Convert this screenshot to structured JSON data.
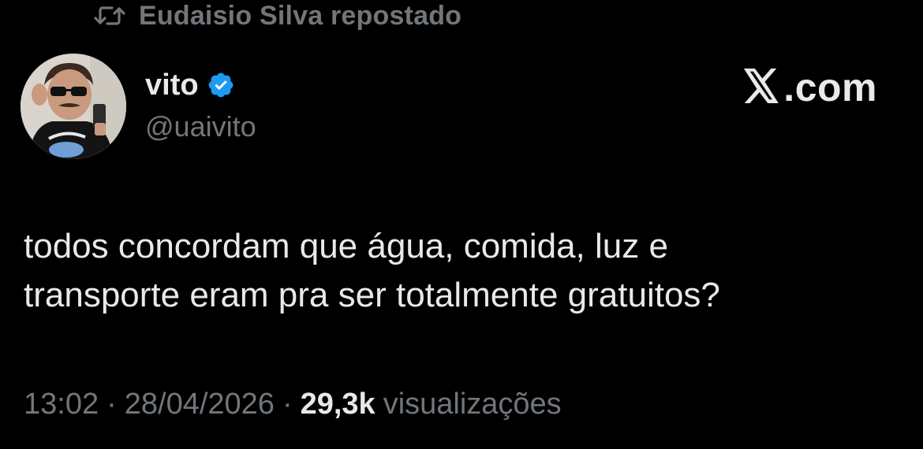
{
  "repost": {
    "icon": "repost-icon",
    "label": "Eudaisio Silva repostado"
  },
  "author": {
    "avatar_icon": "avatar",
    "display_name": "vito",
    "verified_icon": "verified-badge-icon",
    "verified_color": "#1d9bf0",
    "handle": "@uaivito"
  },
  "brand": {
    "logo_icon": "x-logo-icon",
    "label": ".com"
  },
  "tweet": {
    "lines": [
      "todos concordam que água, comida, luz e",
      "transporte eram pra ser totalmente gratuitos?"
    ]
  },
  "meta": {
    "time": "13:02",
    "separator": "·",
    "date": "28/04/2026",
    "views_count": "29,3k",
    "views_label": "visualizações"
  },
  "colors": {
    "background": "#000000",
    "primary_text": "#e7e9ea",
    "secondary_text": "#71767b"
  }
}
